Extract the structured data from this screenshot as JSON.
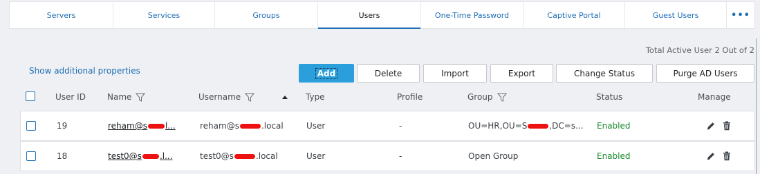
{
  "tabs": [
    {
      "label": "Servers"
    },
    {
      "label": "Services"
    },
    {
      "label": "Groups"
    },
    {
      "label": "Users"
    },
    {
      "label": "One-Time Password"
    },
    {
      "label": "Captive Portal"
    },
    {
      "label": "Guest Users"
    },
    {
      "label": "•••"
    }
  ],
  "summary": "Total Active User 2 Out of 2",
  "show_props": "Show additional properties",
  "toolbar": {
    "add": "Add",
    "delete": "Delete",
    "import": "Import",
    "export": "Export",
    "change_status": "Change Status",
    "purge": "Purge AD Users"
  },
  "columns": {
    "user_id": "User ID",
    "name": "Name",
    "username": "Username",
    "type": "Type",
    "profile": "Profile",
    "group": "Group",
    "status": "Status",
    "manage": "Manage"
  },
  "rows": [
    {
      "user_id": "19",
      "name_a": "reham@s",
      "name_b": "l...",
      "username_a": "reham@s",
      "username_b": ".local",
      "type": "User",
      "profile": "-",
      "group_a": "OU=HR,OU=S",
      "group_b": ",DC=s...",
      "status": "Enabled"
    },
    {
      "user_id": "18",
      "name_a": "test0@s",
      "name_b": ".l...",
      "username_a": "test0@s",
      "username_b": ".local",
      "type": "User",
      "profile": "-",
      "group_a": "Open Group",
      "group_b": "",
      "status": "Enabled"
    }
  ],
  "colors": {
    "accent": "#1f6fb5",
    "primary_button": "#2a9fdc",
    "enabled": "#1e8a2e"
  }
}
